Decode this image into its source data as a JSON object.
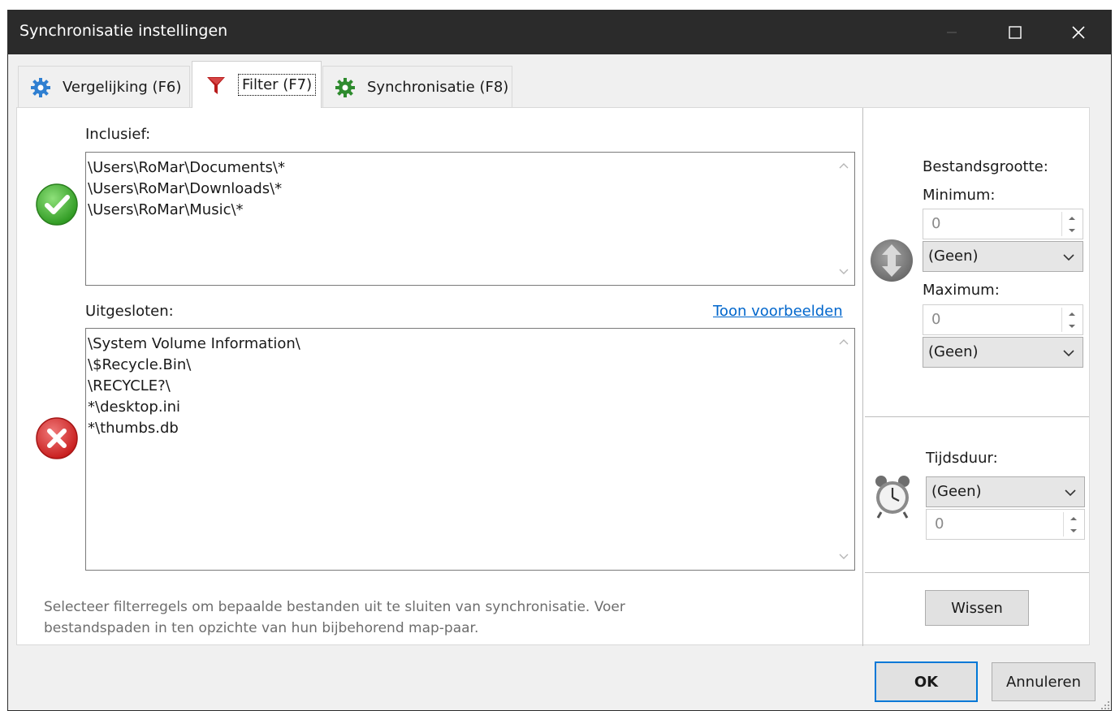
{
  "window": {
    "title": "Synchronisatie instellingen"
  },
  "tabs": [
    {
      "label": "Vergelijking (F6)",
      "icon": "gear-icon",
      "active": false
    },
    {
      "label": "Filter (F7)",
      "icon": "filter-funnel-icon",
      "active": true
    },
    {
      "label": "Synchronisatie (F8)",
      "icon": "green-gear-icon",
      "active": false
    }
  ],
  "filter": {
    "include_label": "Inclusief:",
    "include_lines": "\\Users\\RoMar\\Documents\\*\n\\Users\\RoMar\\Downloads\\*\n\\Users\\RoMar\\Music\\*",
    "exclude_label": "Uitgesloten:",
    "show_examples_link": "Toon voorbeelden",
    "exclude_lines": "\\System Volume Information\\\n\\$Recycle.Bin\\\n\\RECYCLE?\\\n*\\desktop.ini\n*\\thumbs.db",
    "hint": "Selecteer filterregels om bepaalde bestanden uit te sluiten van synchronisatie. Voer bestandspaden in ten opzichte van hun bijbehorend map-paar."
  },
  "size": {
    "label": "Bestandsgrootte:",
    "min_label": "Minimum:",
    "min_value": "0",
    "min_unit": "(Geen)",
    "max_label": "Maximum:",
    "max_value": "0",
    "max_unit": "(Geen)"
  },
  "time": {
    "label": "Tijdsduur:",
    "unit": "(Geen)",
    "value": "0"
  },
  "buttons": {
    "clear": "Wissen",
    "ok": "OK",
    "cancel": "Annuleren"
  },
  "colors": {
    "titlebar": "#2b2b2b",
    "accent": "#0078d7",
    "link": "#0066cc",
    "include_green": "#3dab2e",
    "exclude_red": "#d32f2f"
  }
}
